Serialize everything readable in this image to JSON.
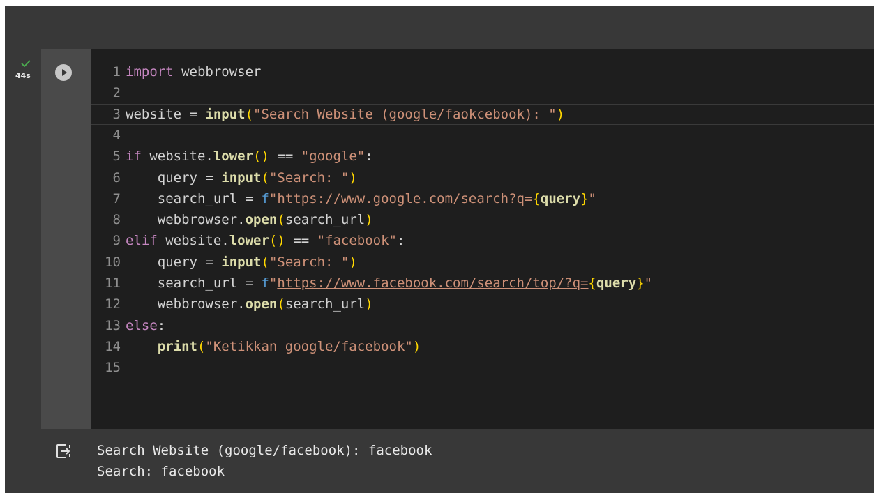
{
  "cell": {
    "exec_time": "44s",
    "status": "success",
    "run_icon": "play-circle-icon",
    "status_icon": "check-icon"
  },
  "code": {
    "lines": [
      {
        "num": "1",
        "tokens": [
          {
            "t": "import",
            "c": "kw"
          },
          {
            "t": " webbrowser",
            "c": "var"
          }
        ]
      },
      {
        "num": "2",
        "tokens": []
      },
      {
        "num": "3",
        "tokens": [
          {
            "t": "website = ",
            "c": "var"
          },
          {
            "t": "input",
            "c": "fn"
          },
          {
            "t": "(",
            "c": "pn"
          },
          {
            "t": "\"Search Website (google/faokcebook): \"",
            "c": "st"
          },
          {
            "t": ")",
            "c": "pn"
          }
        ]
      },
      {
        "num": "4",
        "tokens": []
      },
      {
        "num": "5",
        "tokens": [
          {
            "t": "if",
            "c": "kw"
          },
          {
            "t": " website.",
            "c": "var"
          },
          {
            "t": "lower",
            "c": "fn"
          },
          {
            "t": "()",
            "c": "pn"
          },
          {
            "t": " == ",
            "c": "var"
          },
          {
            "t": "\"google\"",
            "c": "st"
          },
          {
            "t": ":",
            "c": "var"
          }
        ]
      },
      {
        "num": "6",
        "tokens": [
          {
            "t": "    query = ",
            "c": "var"
          },
          {
            "t": "input",
            "c": "fn"
          },
          {
            "t": "(",
            "c": "pn"
          },
          {
            "t": "\"Search: \"",
            "c": "st"
          },
          {
            "t": ")",
            "c": "pn"
          }
        ]
      },
      {
        "num": "7",
        "tokens": [
          {
            "t": "    search_url = ",
            "c": "var"
          },
          {
            "t": "f",
            "c": "fs"
          },
          {
            "t": "\"",
            "c": "st"
          },
          {
            "t": "https://www.google.com/search?q=",
            "c": "url"
          },
          {
            "t": "{",
            "c": "pn"
          },
          {
            "t": "query",
            "c": "fn"
          },
          {
            "t": "}",
            "c": "pn"
          },
          {
            "t": "\"",
            "c": "st"
          }
        ]
      },
      {
        "num": "8",
        "tokens": [
          {
            "t": "    webbrowser.",
            "c": "var"
          },
          {
            "t": "open",
            "c": "fn"
          },
          {
            "t": "(",
            "c": "pn"
          },
          {
            "t": "search_url",
            "c": "var"
          },
          {
            "t": ")",
            "c": "pn"
          }
        ]
      },
      {
        "num": "9",
        "tokens": [
          {
            "t": "elif",
            "c": "kw"
          },
          {
            "t": " website.",
            "c": "var"
          },
          {
            "t": "lower",
            "c": "fn"
          },
          {
            "t": "()",
            "c": "pn"
          },
          {
            "t": " == ",
            "c": "var"
          },
          {
            "t": "\"facebook\"",
            "c": "st"
          },
          {
            "t": ":",
            "c": "var"
          }
        ]
      },
      {
        "num": "10",
        "tokens": [
          {
            "t": "    query = ",
            "c": "var"
          },
          {
            "t": "input",
            "c": "fn"
          },
          {
            "t": "(",
            "c": "pn"
          },
          {
            "t": "\"Search: \"",
            "c": "st"
          },
          {
            "t": ")",
            "c": "pn"
          }
        ]
      },
      {
        "num": "11",
        "tokens": [
          {
            "t": "    search_url = ",
            "c": "var"
          },
          {
            "t": "f",
            "c": "fs"
          },
          {
            "t": "\"",
            "c": "st"
          },
          {
            "t": "https://www.facebook.com/search/top/?q=",
            "c": "url"
          },
          {
            "t": "{",
            "c": "pn"
          },
          {
            "t": "query",
            "c": "fn"
          },
          {
            "t": "}",
            "c": "pn"
          },
          {
            "t": "\"",
            "c": "st"
          }
        ]
      },
      {
        "num": "12",
        "tokens": [
          {
            "t": "    webbrowser.",
            "c": "var"
          },
          {
            "t": "open",
            "c": "fn"
          },
          {
            "t": "(",
            "c": "pn"
          },
          {
            "t": "search_url",
            "c": "var"
          },
          {
            "t": ")",
            "c": "pn"
          }
        ]
      },
      {
        "num": "13",
        "tokens": [
          {
            "t": "else",
            "c": "kw"
          },
          {
            "t": ":",
            "c": "var"
          }
        ]
      },
      {
        "num": "14",
        "tokens": [
          {
            "t": "    print",
            "c": "fn"
          },
          {
            "t": "(",
            "c": "pn"
          },
          {
            "t": "\"Ketikkan google/facebook\"",
            "c": "st"
          },
          {
            "t": ")",
            "c": "pn"
          }
        ]
      },
      {
        "num": "15",
        "tokens": []
      }
    ]
  },
  "output": {
    "icon": "output-redirect-icon",
    "lines": [
      "Search Website (google/facebook): facebook",
      "Search: facebook"
    ]
  },
  "colors": {
    "editor_bg": "#1e1e1e",
    "gutter_bg": "#4a4a4a",
    "page_bg": "#383838",
    "keyword": "#c586c0",
    "function": "#dcdcaa",
    "string": "#ce9178",
    "bracket": "#ffd700",
    "fstring_prefix": "#569cd6",
    "success_check": "#4caf50"
  }
}
